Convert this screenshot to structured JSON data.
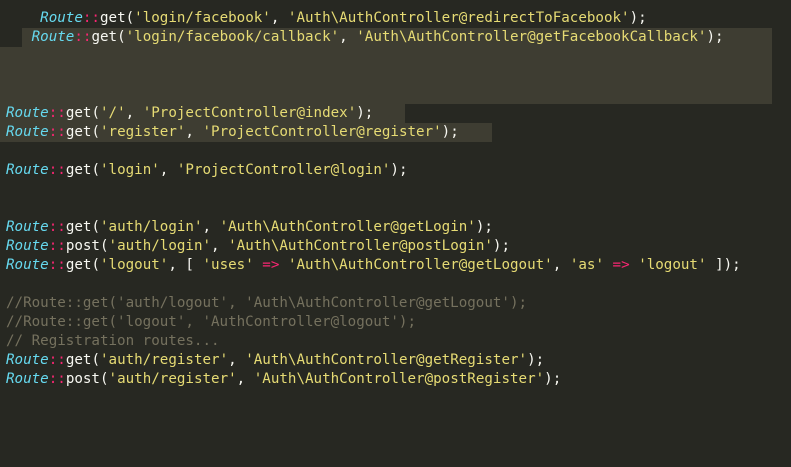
{
  "editor": {
    "colors": {
      "background": "#272822",
      "selection": "#3e3d32",
      "class": "#66d9ef",
      "operator": "#f92672",
      "string": "#e6db74",
      "comment": "#75715e",
      "plain": "#f8f8f2"
    },
    "lines": [
      {
        "indent": "    ",
        "tokens": [
          {
            "t": "Route",
            "k": "cls"
          },
          {
            "t": "::",
            "k": "op"
          },
          {
            "t": "get",
            "k": "fn"
          },
          {
            "t": "(",
            "k": "pun"
          },
          {
            "t": "'login/facebook'",
            "k": "str"
          },
          {
            "t": ", ",
            "k": "pun"
          },
          {
            "t": "'Auth\\AuthController@redirectToFacebook'",
            "k": "str"
          },
          {
            "t": ");",
            "k": "pun"
          }
        ]
      },
      {
        "indent": "   ",
        "tokens": [
          {
            "t": "Route",
            "k": "cls"
          },
          {
            "t": "::",
            "k": "op"
          },
          {
            "t": "get",
            "k": "fn"
          },
          {
            "t": "(",
            "k": "pun"
          },
          {
            "t": "'login/facebook/callback'",
            "k": "str"
          },
          {
            "t": ", ",
            "k": "pun"
          },
          {
            "t": "'Auth\\AuthController@getFacebookCallback'",
            "k": "str"
          },
          {
            "t": ");",
            "k": "pun"
          }
        ]
      },
      {
        "indent": "",
        "tokens": []
      },
      {
        "indent": "",
        "tokens": []
      },
      {
        "indent": "",
        "tokens": []
      },
      {
        "indent": "",
        "tokens": [
          {
            "t": "Route",
            "k": "cls"
          },
          {
            "t": "::",
            "k": "op"
          },
          {
            "t": "get",
            "k": "fn"
          },
          {
            "t": "(",
            "k": "pun"
          },
          {
            "t": "'/'",
            "k": "str"
          },
          {
            "t": ", ",
            "k": "pun"
          },
          {
            "t": "'ProjectController@index'",
            "k": "str"
          },
          {
            "t": ");",
            "k": "pun"
          }
        ]
      },
      {
        "indent": "",
        "tokens": [
          {
            "t": "Route",
            "k": "cls"
          },
          {
            "t": "::",
            "k": "op"
          },
          {
            "t": "get",
            "k": "fn"
          },
          {
            "t": "(",
            "k": "pun"
          },
          {
            "t": "'register'",
            "k": "str"
          },
          {
            "t": ", ",
            "k": "pun"
          },
          {
            "t": "'ProjectController@register'",
            "k": "str"
          },
          {
            "t": ");",
            "k": "pun"
          }
        ]
      },
      {
        "indent": "",
        "tokens": []
      },
      {
        "indent": "",
        "tokens": [
          {
            "t": "Route",
            "k": "cls"
          },
          {
            "t": "::",
            "k": "op"
          },
          {
            "t": "get",
            "k": "fn"
          },
          {
            "t": "(",
            "k": "pun"
          },
          {
            "t": "'login'",
            "k": "str"
          },
          {
            "t": ", ",
            "k": "pun"
          },
          {
            "t": "'ProjectController@login'",
            "k": "str"
          },
          {
            "t": ");",
            "k": "pun"
          }
        ]
      },
      {
        "indent": "",
        "tokens": []
      },
      {
        "indent": "",
        "tokens": []
      },
      {
        "indent": "",
        "tokens": [
          {
            "t": "Route",
            "k": "cls"
          },
          {
            "t": "::",
            "k": "op"
          },
          {
            "t": "get",
            "k": "fn"
          },
          {
            "t": "(",
            "k": "pun"
          },
          {
            "t": "'auth/login'",
            "k": "str"
          },
          {
            "t": ", ",
            "k": "pun"
          },
          {
            "t": "'Auth\\AuthController@getLogin'",
            "k": "str"
          },
          {
            "t": ");",
            "k": "pun"
          }
        ]
      },
      {
        "indent": "",
        "tokens": [
          {
            "t": "Route",
            "k": "cls"
          },
          {
            "t": "::",
            "k": "op"
          },
          {
            "t": "post",
            "k": "fn"
          },
          {
            "t": "(",
            "k": "pun"
          },
          {
            "t": "'auth/login'",
            "k": "str"
          },
          {
            "t": ", ",
            "k": "pun"
          },
          {
            "t": "'Auth\\AuthController@postLogin'",
            "k": "str"
          },
          {
            "t": ");",
            "k": "pun"
          }
        ]
      },
      {
        "indent": "",
        "tokens": [
          {
            "t": "Route",
            "k": "cls"
          },
          {
            "t": "::",
            "k": "op"
          },
          {
            "t": "get",
            "k": "fn"
          },
          {
            "t": "(",
            "k": "pun"
          },
          {
            "t": "'logout'",
            "k": "str"
          },
          {
            "t": ", [ ",
            "k": "pun"
          },
          {
            "t": "'uses'",
            "k": "str"
          },
          {
            "t": " ",
            "k": "pun"
          },
          {
            "t": "=>",
            "k": "op"
          },
          {
            "t": " ",
            "k": "pun"
          },
          {
            "t": "'Auth\\AuthController@getLogout'",
            "k": "str"
          },
          {
            "t": ", ",
            "k": "pun"
          },
          {
            "t": "'as'",
            "k": "str"
          },
          {
            "t": " ",
            "k": "pun"
          },
          {
            "t": "=>",
            "k": "op"
          },
          {
            "t": " ",
            "k": "pun"
          },
          {
            "t": "'logout'",
            "k": "str"
          },
          {
            "t": " ]);",
            "k": "pun"
          }
        ]
      },
      {
        "indent": "",
        "tokens": []
      },
      {
        "indent": "",
        "tokens": [
          {
            "t": "//Route::get('auth/logout', 'Auth\\AuthController@getLogout');",
            "k": "cmt"
          }
        ]
      },
      {
        "indent": "",
        "tokens": [
          {
            "t": "//Route::get('logout', 'AuthController@logout');",
            "k": "cmt"
          }
        ]
      },
      {
        "indent": "",
        "tokens": [
          {
            "t": "// Registration routes...",
            "k": "cmt"
          }
        ]
      },
      {
        "indent": "",
        "tokens": [
          {
            "t": "Route",
            "k": "cls"
          },
          {
            "t": "::",
            "k": "op"
          },
          {
            "t": "get",
            "k": "fn"
          },
          {
            "t": "(",
            "k": "pun"
          },
          {
            "t": "'auth/register'",
            "k": "str"
          },
          {
            "t": ", ",
            "k": "pun"
          },
          {
            "t": "'Auth\\AuthController@getRegister'",
            "k": "str"
          },
          {
            "t": ");",
            "k": "pun"
          }
        ]
      },
      {
        "indent": "",
        "tokens": [
          {
            "t": "Route",
            "k": "cls"
          },
          {
            "t": "::",
            "k": "op"
          },
          {
            "t": "post",
            "k": "fn"
          },
          {
            "t": "(",
            "k": "pun"
          },
          {
            "t": "'auth/register'",
            "k": "str"
          },
          {
            "t": ", ",
            "k": "pun"
          },
          {
            "t": "'Auth\\AuthController@postRegister'",
            "k": "str"
          },
          {
            "t": ");",
            "k": "pun"
          }
        ]
      }
    ]
  }
}
